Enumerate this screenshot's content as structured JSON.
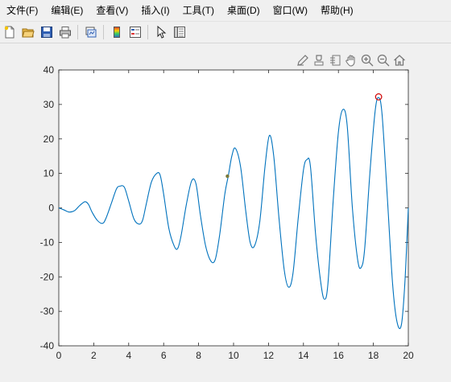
{
  "menu": {
    "items": [
      "文件(F)",
      "编辑(E)",
      "查看(V)",
      "插入(I)",
      "工具(T)",
      "桌面(D)",
      "窗口(W)",
      "帮助(H)"
    ]
  },
  "toolbar": {
    "icons": [
      "new-figure-icon",
      "open-file-icon",
      "save-icon",
      "print-icon",
      "link-plot-icon",
      "colorbar-icon",
      "legend-icon",
      "edit-plot-arrow-icon",
      "property-inspector-icon"
    ]
  },
  "axes_toolbar": {
    "icons": [
      "brush-icon",
      "data-cursor-icon",
      "link-icon",
      "pan-icon",
      "zoom-in-icon",
      "zoom-out-icon",
      "home-icon"
    ]
  },
  "chart_data": {
    "type": "line",
    "title": "",
    "xlabel": "",
    "ylabel": "",
    "xlim": [
      0,
      20
    ],
    "ylim": [
      -40,
      40
    ],
    "xticks": [
      0,
      2,
      4,
      6,
      8,
      10,
      12,
      14,
      16,
      18,
      20
    ],
    "yticks": [
      40,
      30,
      20,
      10,
      0,
      -10,
      -20,
      -30,
      -40
    ],
    "grid": false,
    "line_color": "#0072bd",
    "series": [
      {
        "x": [
          0,
          0.3,
          0.6,
          0.9,
          1.2,
          1.5,
          1.7,
          1.9,
          2.2,
          2.5,
          2.7,
          3.0,
          3.3,
          3.5,
          3.75,
          4.0,
          4.3,
          4.6,
          4.8,
          5.0,
          5.3,
          5.6,
          5.8,
          6.0,
          6.3,
          6.6,
          6.8,
          7.0,
          7.3,
          7.6,
          7.85,
          8.1,
          8.4,
          8.7,
          8.95,
          9.2,
          9.5,
          9.7,
          9.9,
          10.1,
          10.4,
          10.7,
          10.95,
          11.2,
          11.5,
          11.8,
          12.05,
          12.3,
          12.6,
          12.9,
          13.15,
          13.4,
          13.7,
          14.0,
          14.2,
          14.4,
          14.7,
          15.0,
          15.2,
          15.4,
          15.7,
          16.0,
          16.25,
          16.5,
          16.8,
          17.1,
          17.3,
          17.5,
          17.8,
          18.1,
          18.3,
          18.5,
          18.8,
          19.1,
          19.35,
          19.6,
          19.8,
          20.0
        ],
        "y": [
          0,
          -0.6,
          -1.2,
          -0.8,
          0.7,
          1.8,
          1.0,
          -1.2,
          -3.6,
          -4.5,
          -3.0,
          1.2,
          5.5,
          6.3,
          6.0,
          2.0,
          -3.2,
          -4.7,
          -3.5,
          1.0,
          7.5,
          10.0,
          9.5,
          4.0,
          -6.0,
          -11.0,
          -11.8,
          -8.0,
          1.0,
          7.8,
          7.0,
          -2.0,
          -11.0,
          -15.4,
          -15.0,
          -8.0,
          4.0,
          9.3,
          15.0,
          17.3,
          12.0,
          -1.0,
          -10.0,
          -11.0,
          -4.0,
          12.0,
          21.0,
          15.0,
          -3.0,
          -18.0,
          -23.0,
          -19.0,
          -3.0,
          11.0,
          14.0,
          12.0,
          -8.0,
          -22.0,
          -26.5,
          -22.0,
          2.0,
          22.0,
          28.5,
          24.0,
          0.0,
          -15.0,
          -17.3,
          -12.0,
          10.0,
          28.0,
          32.0,
          27.0,
          3.0,
          -22.0,
          -33.0,
          -34.0,
          -22.0,
          0.0
        ]
      }
    ],
    "markers": [
      {
        "kind": "data-tip-dot",
        "x": 9.65,
        "y": 9.2,
        "color": "#7a7a3a"
      },
      {
        "kind": "circle",
        "x": 18.3,
        "y": 32.2,
        "color": "#d00000"
      }
    ]
  }
}
